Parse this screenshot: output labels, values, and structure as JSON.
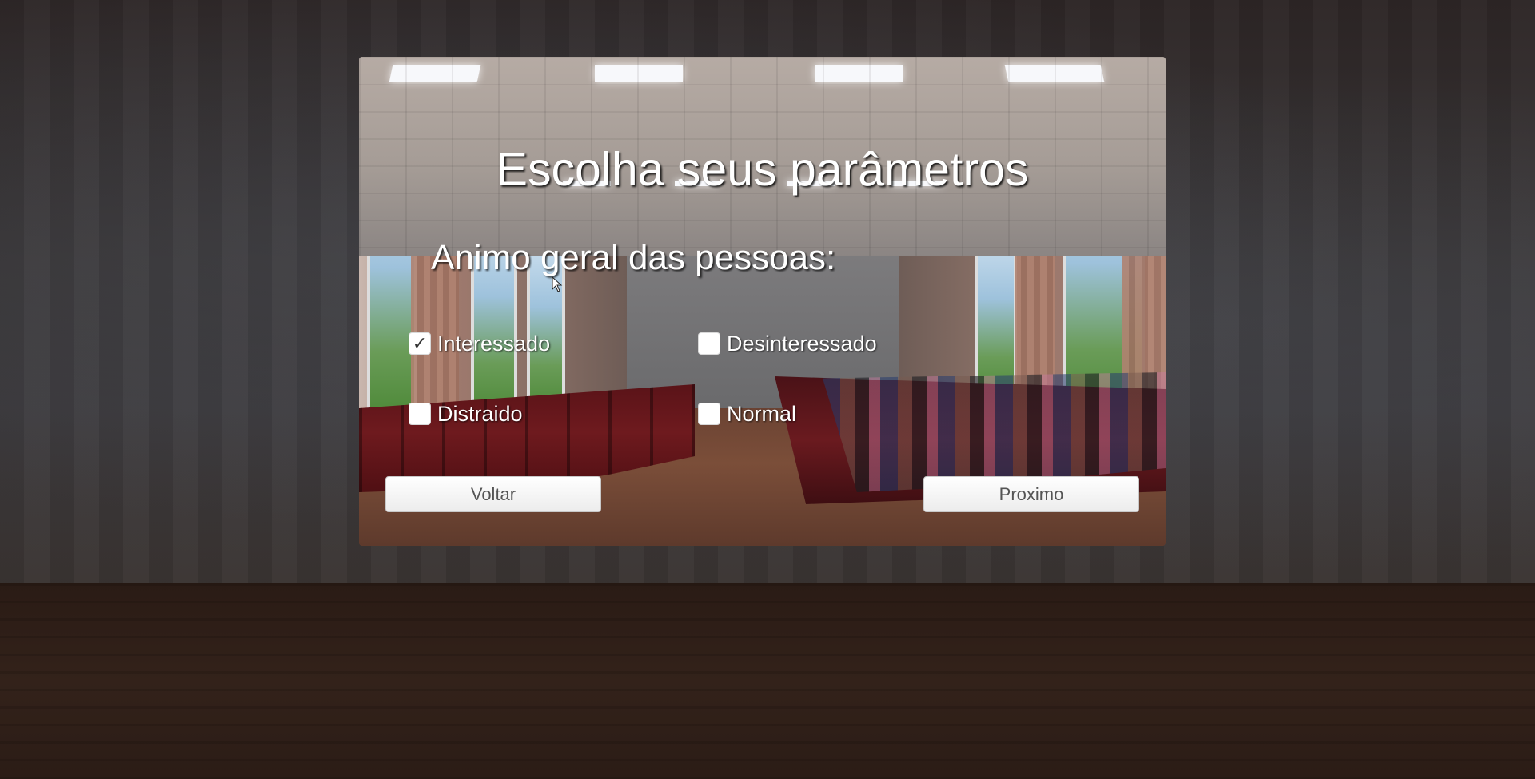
{
  "title": "Escolha seus parâmetros",
  "subtitle": "Animo geral das pessoas:",
  "options": [
    {
      "label": "Interessado",
      "checked": true,
      "check_glyph": "✓"
    },
    {
      "label": "Desinteressado",
      "checked": false,
      "check_glyph": ""
    },
    {
      "label": "Distraido",
      "checked": false,
      "check_glyph": ""
    },
    {
      "label": "Normal",
      "checked": false,
      "check_glyph": ""
    }
  ],
  "buttons": {
    "back_label": "Voltar",
    "next_label": "Proximo"
  },
  "icons": {
    "check": "check-icon",
    "cursor": "mouse-cursor-icon"
  },
  "colors": {
    "text": "#ffffff",
    "button_bg": "#f2f2f2",
    "button_text": "#555555"
  }
}
